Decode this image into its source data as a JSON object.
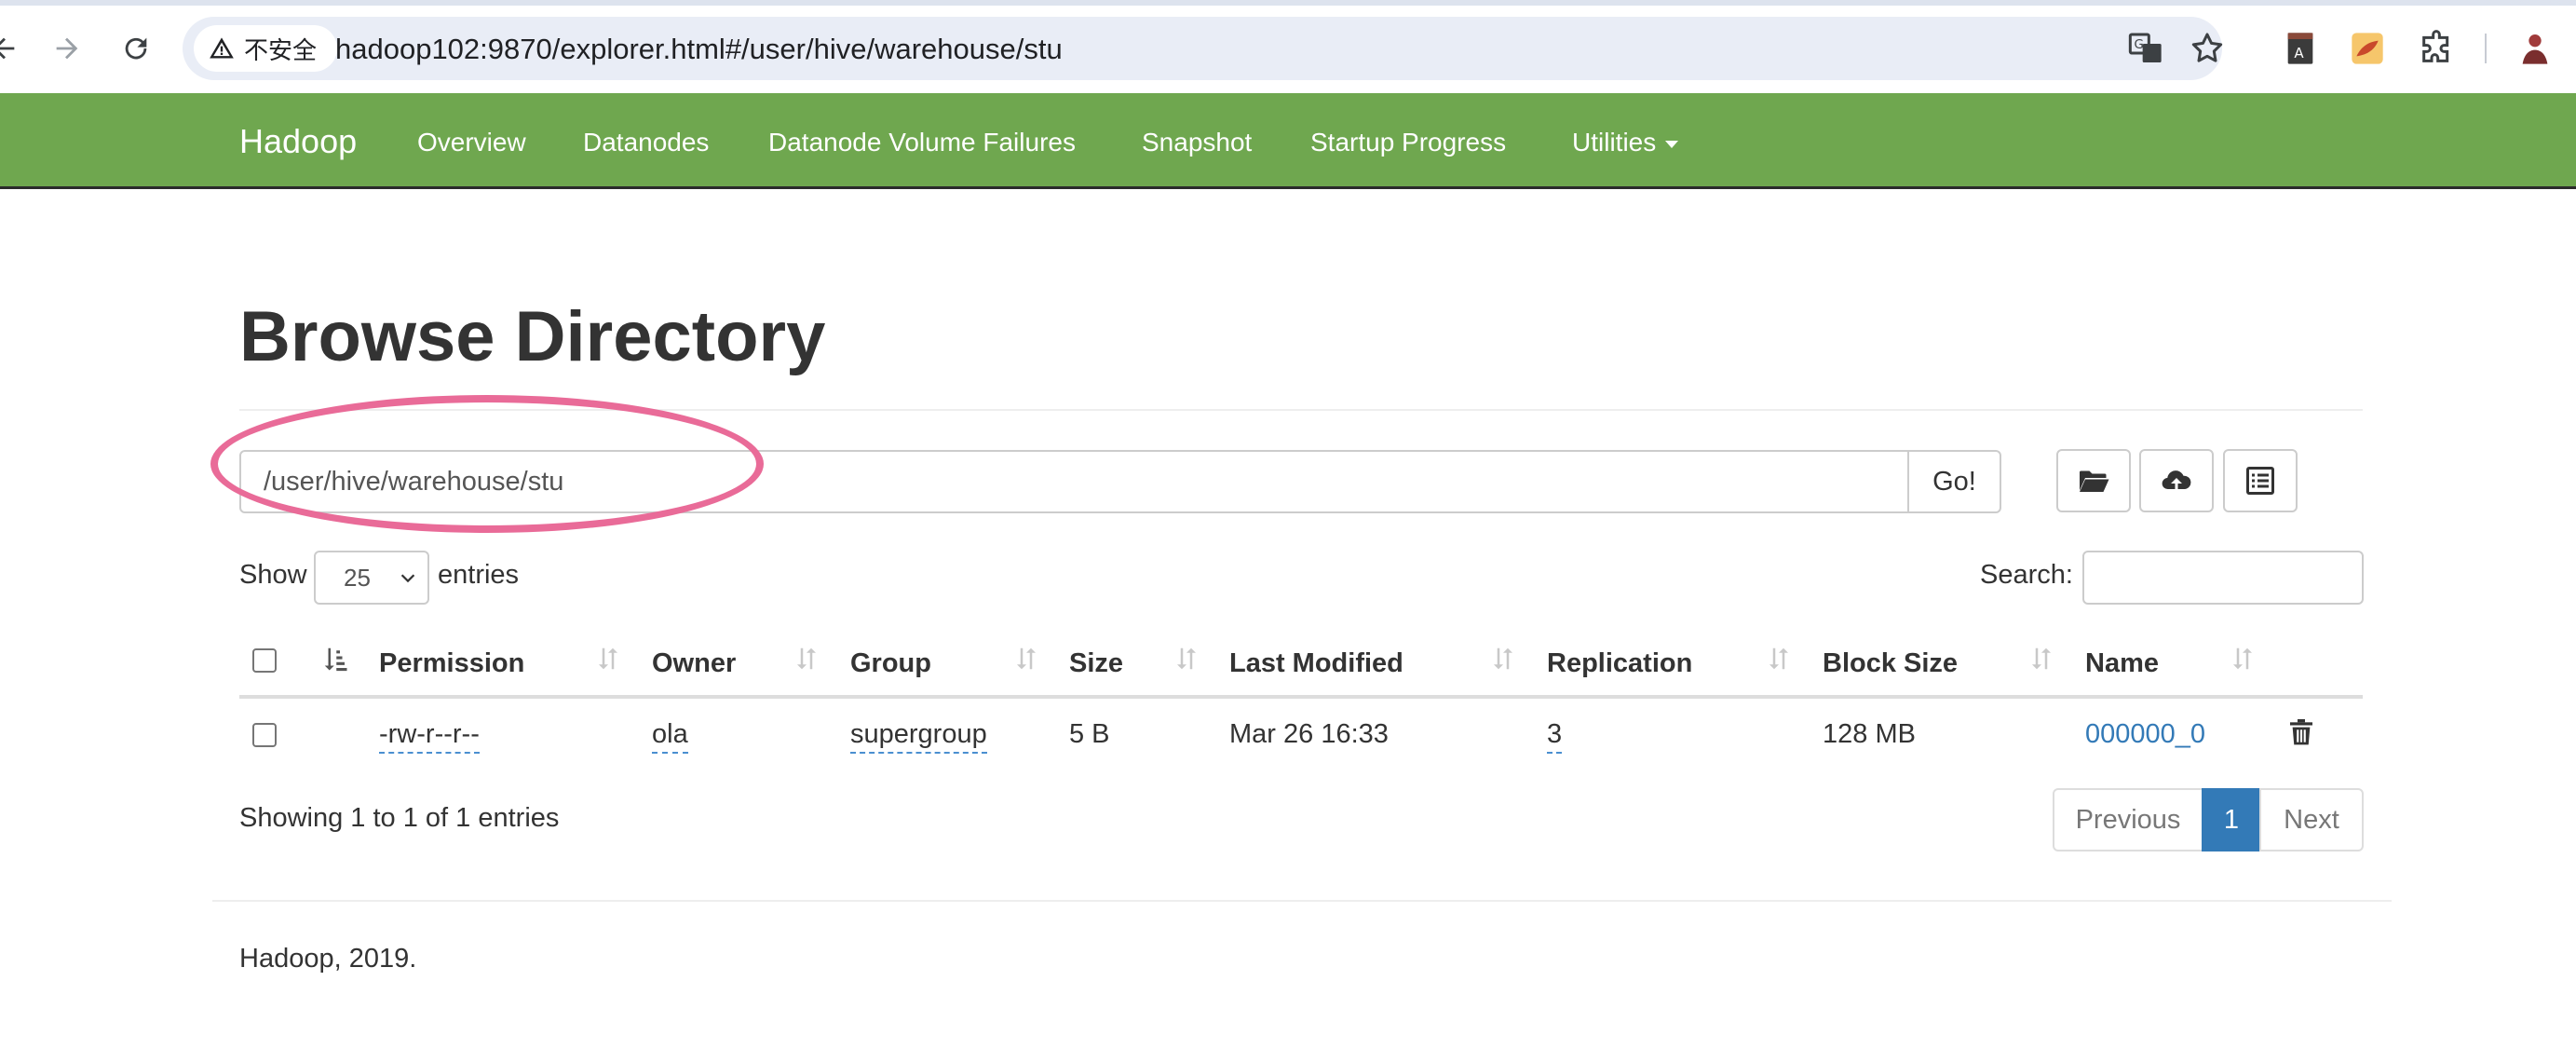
{
  "browser": {
    "security_label": "不安全",
    "url": "hadoop102:9870/explorer.html#/user/hive/warehouse/stu"
  },
  "navbar": {
    "brand": "Hadoop",
    "items": [
      {
        "label": "Overview"
      },
      {
        "label": "Datanodes"
      },
      {
        "label": "Datanode Volume Failures"
      },
      {
        "label": "Snapshot"
      },
      {
        "label": "Startup Progress"
      },
      {
        "label": "Utilities"
      }
    ]
  },
  "page": {
    "title": "Browse Directory",
    "path_value": "/user/hive/warehouse/stu",
    "go_label": "Go!",
    "tools": [
      "create-directory-icon",
      "upload-icon",
      "cut-paste-icon"
    ],
    "show_label": "Show",
    "entries_value": "25",
    "entries_label": "entries",
    "search_label": "Search:",
    "search_value": ""
  },
  "table": {
    "headers": [
      "Permission",
      "Owner",
      "Group",
      "Size",
      "Last Modified",
      "Replication",
      "Block Size",
      "Name"
    ],
    "rows": [
      {
        "permission": "-rw-r--r--",
        "owner": "ola",
        "group": "supergroup",
        "size": "5 B",
        "last_modified": "Mar 26 16:33",
        "replication": "3",
        "block_size": "128 MB",
        "name": "000000_0"
      }
    ]
  },
  "footer_info": {
    "showing": "Showing 1 to 1 of 1 entries",
    "previous": "Previous",
    "current_page": "1",
    "next": "Next",
    "copyright": "Hadoop, 2019."
  },
  "colors": {
    "navbar": "#6fa74f",
    "link": "#337ab7",
    "annotation_ellipse": "#e96b98"
  }
}
